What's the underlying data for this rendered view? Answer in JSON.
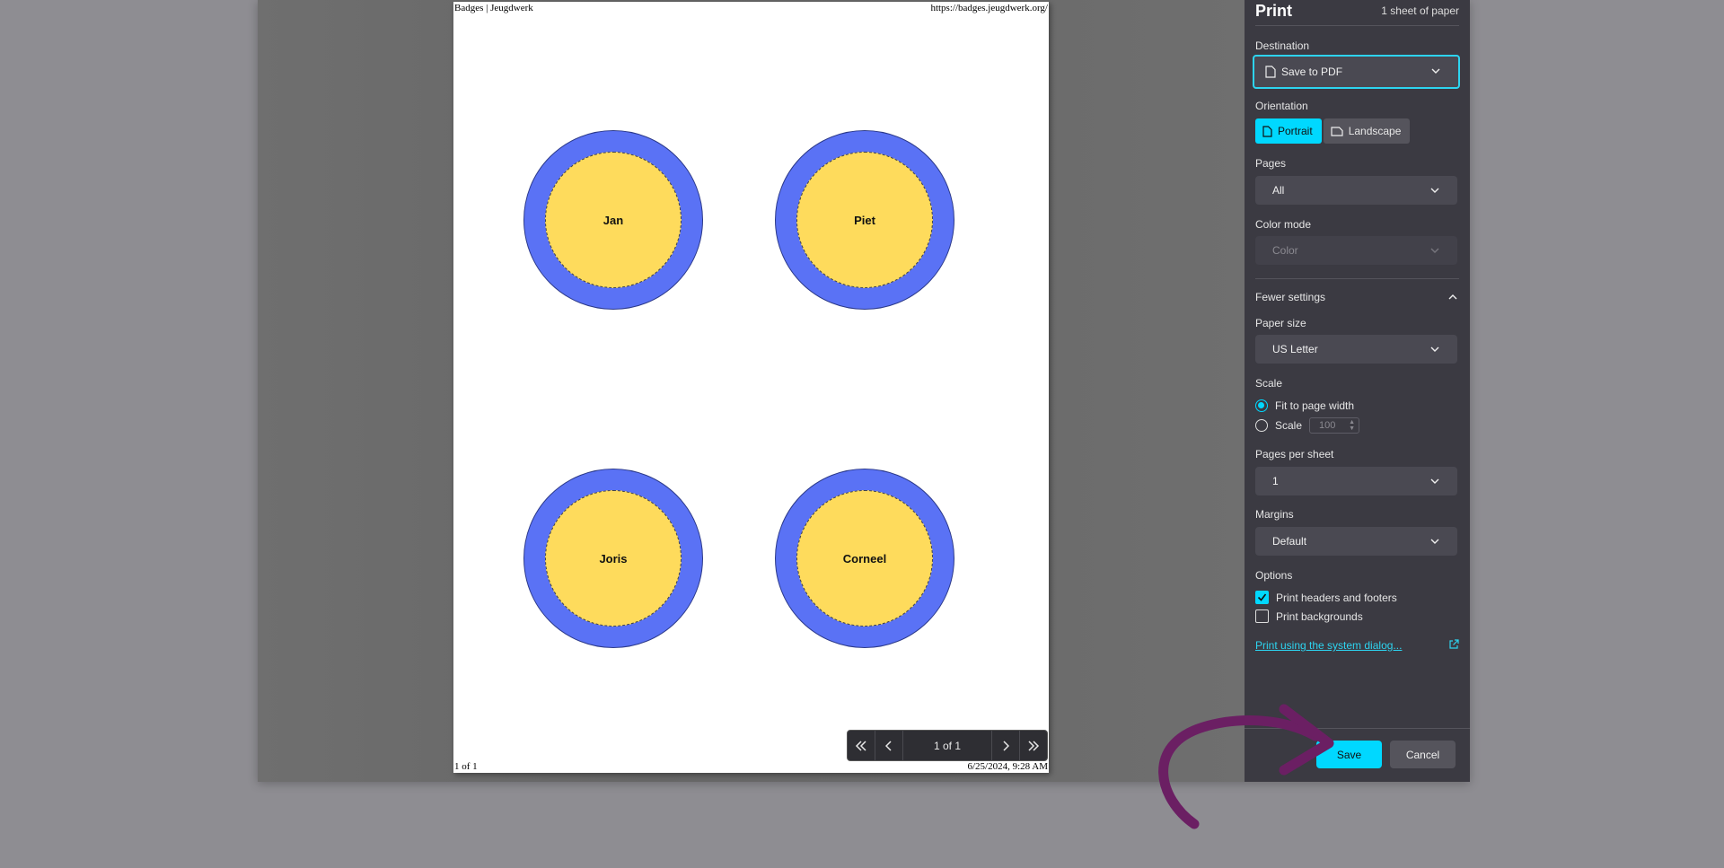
{
  "preview": {
    "header_left": "Badges | Jeugdwerk",
    "header_right": "https://badges.jeugdwerk.org/",
    "footer_left": "1 of 1",
    "footer_right": "6/25/2024, 9:28 AM",
    "badges": [
      "Jan",
      "Piet",
      "Joris",
      "Corneel"
    ],
    "page_indicator": "1 of 1"
  },
  "colors": {
    "badge_outer": "#5a72f5",
    "badge_inner": "#fedb5c",
    "accent": "#00d8ff",
    "panel_bg": "#3b3a42",
    "annotation_arrow": "#6b1f63"
  },
  "print": {
    "title": "Print",
    "sheets": "1 sheet of paper",
    "destination_label": "Destination",
    "destination_value": "Save to PDF",
    "orientation_label": "Orientation",
    "orientation_portrait": "Portrait",
    "orientation_landscape": "Landscape",
    "orientation_selected": "Portrait",
    "pages_label": "Pages",
    "pages_value": "All",
    "color_mode_label": "Color mode",
    "color_mode_value": "Color",
    "fewer_settings": "Fewer settings",
    "paper_size_label": "Paper size",
    "paper_size_value": "US Letter",
    "scale_label": "Scale",
    "scale_fit": "Fit to page width",
    "scale_custom": "Scale",
    "scale_value": "100",
    "pages_per_sheet_label": "Pages per sheet",
    "pages_per_sheet_value": "1",
    "margins_label": "Margins",
    "margins_value": "Default",
    "options_label": "Options",
    "option_headers_footers": "Print headers and footers",
    "option_headers_footers_checked": true,
    "option_backgrounds": "Print backgrounds",
    "option_backgrounds_checked": false,
    "system_dialog_link": "Print using the system dialog...",
    "save_button": "Save",
    "cancel_button": "Cancel"
  }
}
